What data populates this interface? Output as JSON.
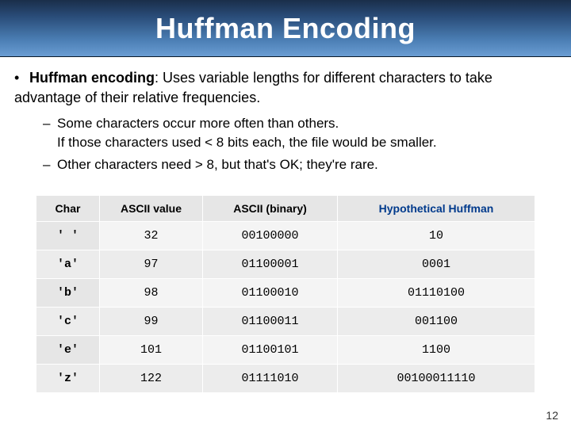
{
  "title": "Huffman Encoding",
  "bullet": {
    "term": "Huffman encoding",
    "desc": ": Uses variable lengths for different characters to take advantage of their relative frequencies."
  },
  "sub": [
    "Some characters occur more often than others.\nIf those characters used < 8 bits each, the file would be smaller.",
    "Other characters need > 8, but that's OK;  they're rare."
  ],
  "chart_data": {
    "type": "table",
    "headers": [
      "Char",
      "ASCII value",
      "ASCII (binary)",
      "Hypothetical Huffman"
    ],
    "rows": [
      {
        "char": "' '",
        "ascii_value": "32",
        "ascii_binary": "00100000",
        "huffman": "10"
      },
      {
        "char": "'a'",
        "ascii_value": "97",
        "ascii_binary": "01100001",
        "huffman": "0001"
      },
      {
        "char": "'b'",
        "ascii_value": "98",
        "ascii_binary": "01100010",
        "huffman": "01110100"
      },
      {
        "char": "'c'",
        "ascii_value": "99",
        "ascii_binary": "01100011",
        "huffman": "001100"
      },
      {
        "char": "'e'",
        "ascii_value": "101",
        "ascii_binary": "01100101",
        "huffman": "1100"
      },
      {
        "char": "'z'",
        "ascii_value": "122",
        "ascii_binary": "01111010",
        "huffman": "00100011110"
      }
    ]
  },
  "page_number": "12"
}
